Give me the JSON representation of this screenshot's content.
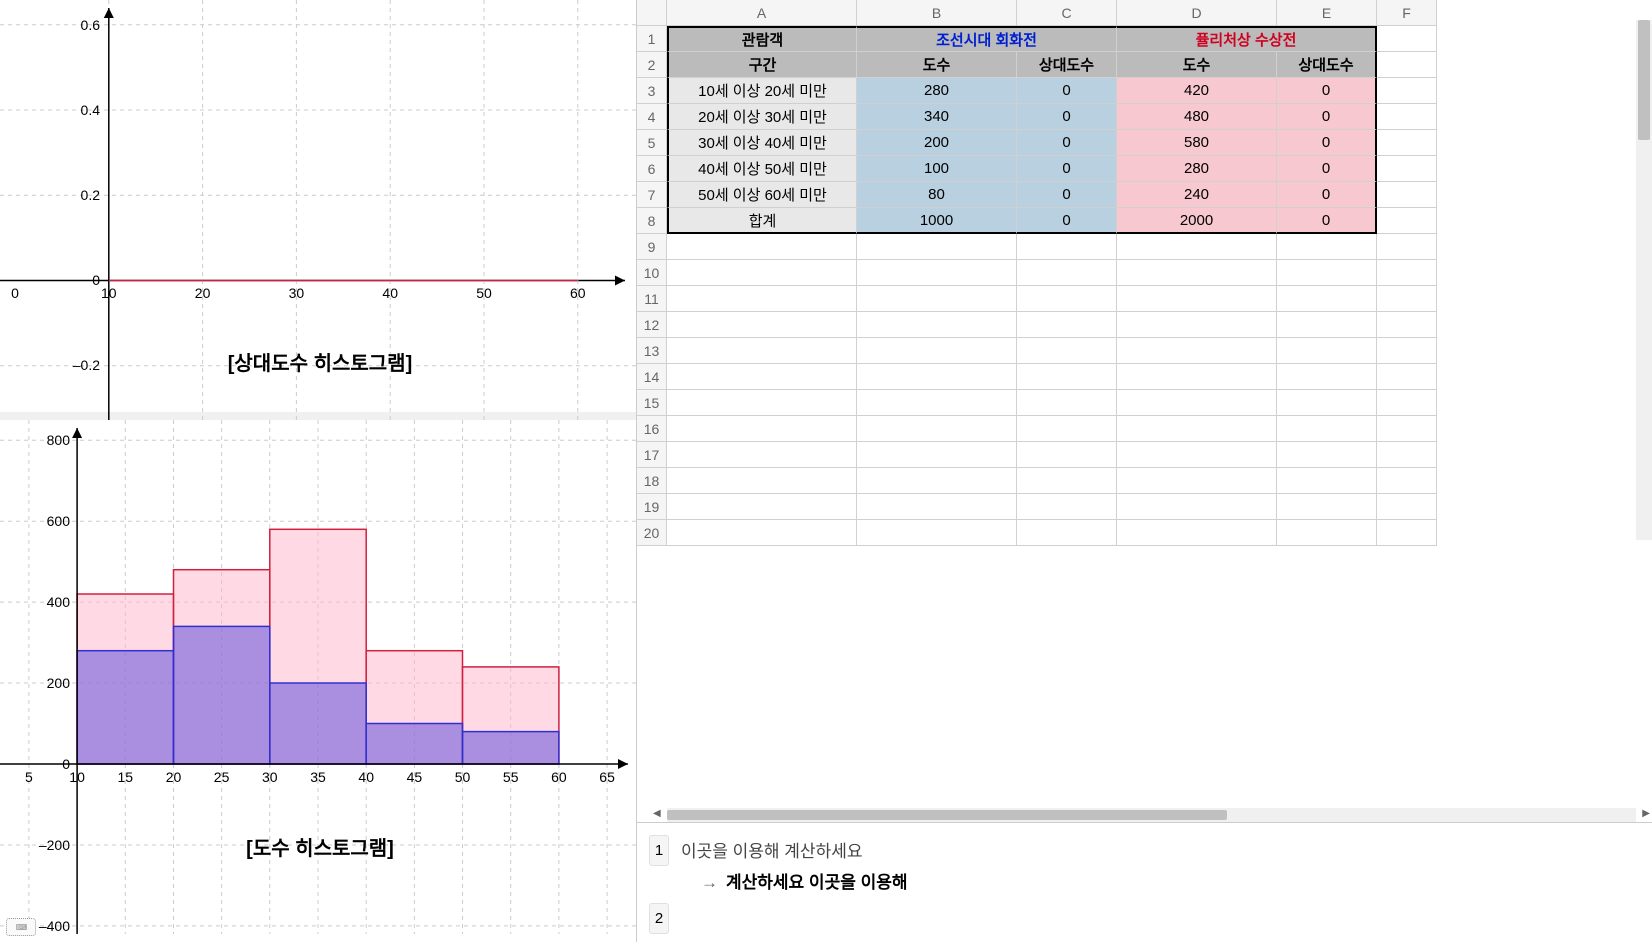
{
  "chart_data": [
    {
      "type": "bar",
      "title": "[상대도수 히스토그램]",
      "x_range": [
        0,
        65
      ],
      "y_range": [
        -0.3,
        0.65
      ],
      "x_ticks": [
        0,
        10,
        20,
        30,
        40,
        50,
        60
      ],
      "y_ticks": [
        -0.2,
        0,
        0.2,
        0.4,
        0.6
      ],
      "bins": [
        [
          10,
          20
        ],
        [
          20,
          30
        ],
        [
          30,
          40
        ],
        [
          40,
          50
        ],
        [
          50,
          60
        ]
      ],
      "series": [
        {
          "name": "조선시대 회화전",
          "color": "blue",
          "values": [
            0,
            0,
            0,
            0,
            0
          ]
        },
        {
          "name": "퓰리처상 수상전",
          "color": "red",
          "values": [
            0,
            0,
            0,
            0,
            0
          ]
        }
      ]
    },
    {
      "type": "bar",
      "title": "[도수 히스토그램]",
      "x_range": [
        2,
        68
      ],
      "y_range": [
        -420,
        850
      ],
      "x_ticks": [
        5,
        10,
        15,
        20,
        25,
        30,
        35,
        40,
        45,
        50,
        55,
        60,
        65
      ],
      "y_ticks": [
        -400,
        -200,
        0,
        200,
        400,
        600,
        800
      ],
      "bins": [
        [
          10,
          20
        ],
        [
          20,
          30
        ],
        [
          30,
          40
        ],
        [
          40,
          50
        ],
        [
          50,
          60
        ]
      ],
      "series": [
        {
          "name": "조선시대 회화전",
          "color": "blue",
          "values": [
            280,
            340,
            200,
            100,
            80
          ]
        },
        {
          "name": "퓰리처상 수상전",
          "color": "red",
          "values": [
            420,
            480,
            580,
            280,
            240
          ]
        }
      ]
    }
  ],
  "spreadsheet": {
    "columns": [
      "A",
      "B",
      "C",
      "D",
      "E",
      "F"
    ],
    "header1": {
      "A": "관람객",
      "BC": "조선시대 회화전",
      "DE": "퓰리처상 수상전"
    },
    "header2": {
      "A": "구간",
      "B": "도수",
      "C": "상대도수",
      "D": "도수",
      "E": "상대도수"
    },
    "rows": [
      {
        "label": "10세 이상 20세 미만",
        "b": 280,
        "c": 0,
        "d": 420,
        "e": 0
      },
      {
        "label": "20세 이상 30세 미만",
        "b": 340,
        "c": 0,
        "d": 480,
        "e": 0
      },
      {
        "label": "30세 이상 40세 미만",
        "b": 200,
        "c": 0,
        "d": 580,
        "e": 0
      },
      {
        "label": "40세 이상 50세 미만",
        "b": 100,
        "c": 0,
        "d": 280,
        "e": 0
      },
      {
        "label": "50세 이상 60세 미만",
        "b": 80,
        "c": 0,
        "d": 240,
        "e": 0
      }
    ],
    "total": {
      "label": "합계",
      "b": 1000,
      "c": 0,
      "d": 2000,
      "e": 0
    },
    "visible_row_numbers": [
      1,
      2,
      3,
      4,
      5,
      6,
      7,
      8,
      9,
      10,
      11,
      12,
      13,
      14,
      15,
      16,
      17,
      18,
      19,
      20
    ]
  },
  "cas": {
    "row1_input": "이곳을 이용해 계산하세요",
    "row1_output": "계산하세요 이곳을 이용해",
    "row1_num": "1",
    "row2_num": "2"
  }
}
